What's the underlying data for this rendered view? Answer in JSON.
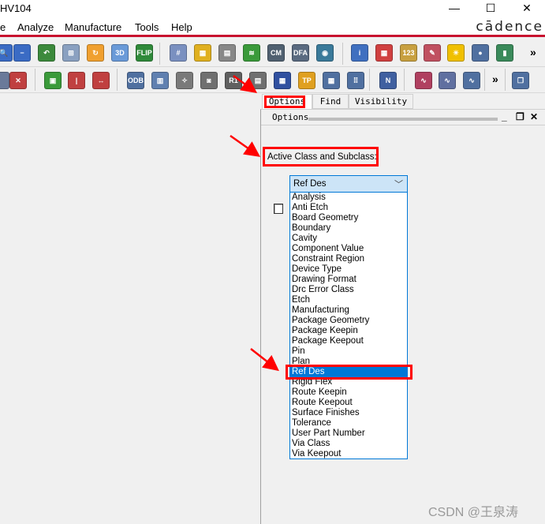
{
  "window": {
    "title": "HV104",
    "minimize": "—",
    "maximize": "☐",
    "close": "✕"
  },
  "menu": [
    "e",
    "Analyze",
    "Manufacture",
    "Tools",
    "Help"
  ],
  "brand": "cādence",
  "toolbar1": [
    {
      "icon": "zoom-in-icon",
      "color": "#3a6bc4",
      "glyph": "🔍"
    },
    {
      "icon": "zoom-out-icon",
      "color": "#3a6bc4",
      "glyph": "−"
    },
    {
      "icon": "zoom-previous-icon",
      "color": "#3c8a3c",
      "glyph": "↶"
    },
    {
      "icon": "zoom-fit-icon",
      "color": "#8aa0c0",
      "glyph": "⊞"
    },
    {
      "icon": "redraw-icon",
      "color": "#f0a030",
      "glyph": "↻"
    },
    {
      "icon": "3d-view-icon",
      "color": "#6a9ad8",
      "glyph": "3D"
    },
    {
      "icon": "flip-board-icon",
      "color": "#2f8a3a",
      "glyph": "FLIP"
    },
    {
      "icon": "grid-icon",
      "color": "#7a90c0",
      "glyph": "#"
    },
    {
      "icon": "color-icon",
      "color": "#e0b020",
      "glyph": "▦"
    },
    {
      "icon": "shadow-icon",
      "color": "#888888",
      "glyph": "▤"
    },
    {
      "icon": "layers-icon",
      "color": "#3a9a3a",
      "glyph": "≋"
    },
    {
      "icon": "constraint-manager-icon",
      "color": "#506070",
      "glyph": "CM"
    },
    {
      "icon": "dfa-icon",
      "color": "#5a6a80",
      "glyph": "DFA"
    },
    {
      "icon": "globe-icon",
      "color": "#3a7a9a",
      "glyph": "◉"
    },
    {
      "icon": "info-icon",
      "color": "#4070c0",
      "glyph": "i"
    },
    {
      "icon": "element-info-icon",
      "color": "#d04040",
      "glyph": "▦"
    },
    {
      "icon": "measure-icon",
      "color": "#c8a040",
      "glyph": "123"
    },
    {
      "icon": "brush-icon",
      "color": "#c05060",
      "glyph": "✎"
    },
    {
      "icon": "light-icon",
      "color": "#f0c000",
      "glyph": "☀"
    },
    {
      "icon": "highlight-icon",
      "color": "#5070a0",
      "glyph": "●"
    },
    {
      "icon": "stats-icon",
      "color": "#3a8a5a",
      "glyph": "▮"
    }
  ],
  "toolbar1_more": "»",
  "toolbar2": [
    {
      "icon": "partial-icon",
      "color": "#6a7a9a",
      "glyph": ""
    },
    {
      "icon": "delete-icon",
      "color": "#c04040",
      "glyph": "✕"
    },
    {
      "icon": "component-icon",
      "color": "#3a9a3a",
      "glyph": "▣"
    },
    {
      "icon": "dimension-vertical-icon",
      "color": "#c04040",
      "glyph": "|"
    },
    {
      "icon": "dimension-horizontal-icon",
      "color": "#c04040",
      "glyph": "↔"
    },
    {
      "icon": "odb-export-icon",
      "color": "#5070a0",
      "glyph": "ODB"
    },
    {
      "icon": "columns-icon",
      "color": "#6080b0",
      "glyph": "▥"
    },
    {
      "icon": "wrench-icon",
      "color": "#7a7a7a",
      "glyph": "✧"
    },
    {
      "icon": "camera-icon",
      "color": "#707070",
      "glyph": "◙"
    },
    {
      "icon": "renumber-icon",
      "color": "#606060",
      "glyph": "R1"
    },
    {
      "icon": "document-icon",
      "color": "#707070",
      "glyph": "▤"
    },
    {
      "icon": "matrix-icon",
      "color": "#3050a0",
      "glyph": "▦"
    },
    {
      "icon": "testpoint-icon",
      "color": "#e0a020",
      "glyph": "TP"
    },
    {
      "icon": "grid-pads-icon",
      "color": "#5070a0",
      "glyph": "▦"
    },
    {
      "icon": "pad-array-icon",
      "color": "#5070a0",
      "glyph": "⠿"
    },
    {
      "icon": "route-icon",
      "color": "#4060a0",
      "glyph": "N"
    },
    {
      "icon": "report-icon",
      "color": "#b04060",
      "glyph": "∿"
    },
    {
      "icon": "book-icon",
      "color": "#6070a0",
      "glyph": "∿"
    },
    {
      "icon": "chip-icon",
      "color": "#5070a0",
      "glyph": "∿"
    },
    {
      "icon": "pages-icon",
      "color": "#5070a0",
      "glyph": "❐"
    }
  ],
  "toolbar2_more": "»",
  "tabs": [
    {
      "label": "Options",
      "active": true
    },
    {
      "label": "Find",
      "active": false
    },
    {
      "label": "Visibility",
      "active": false
    }
  ],
  "panel": {
    "title": "Options",
    "minimize": "_",
    "float": "❐",
    "close": "✕"
  },
  "active_class_label": "Active Class and Subclass:",
  "class_select": {
    "selected": "Ref Des",
    "options": [
      "Analysis",
      "Anti Etch",
      "Board Geometry",
      "Boundary",
      "Cavity",
      "Component Value",
      "Constraint Region",
      "Device Type",
      "Drawing Format",
      "Drc Error Class",
      "Etch",
      "Manufacturing",
      "Package Geometry",
      "Package Keepin",
      "Package Keepout",
      "Pin",
      "Plan",
      "Ref Des",
      "Rigid Flex",
      "Route Keepin",
      "Route Keepout",
      "Surface Finishes",
      "Tolerance",
      "User Part Number",
      "Via Class",
      "Via Keepout"
    ]
  },
  "colors": {
    "accent": "#0078d7",
    "highlight_annotation": "#ff0000",
    "brand_line": "#c8102e"
  },
  "watermark": "CSDN @王泉涛"
}
